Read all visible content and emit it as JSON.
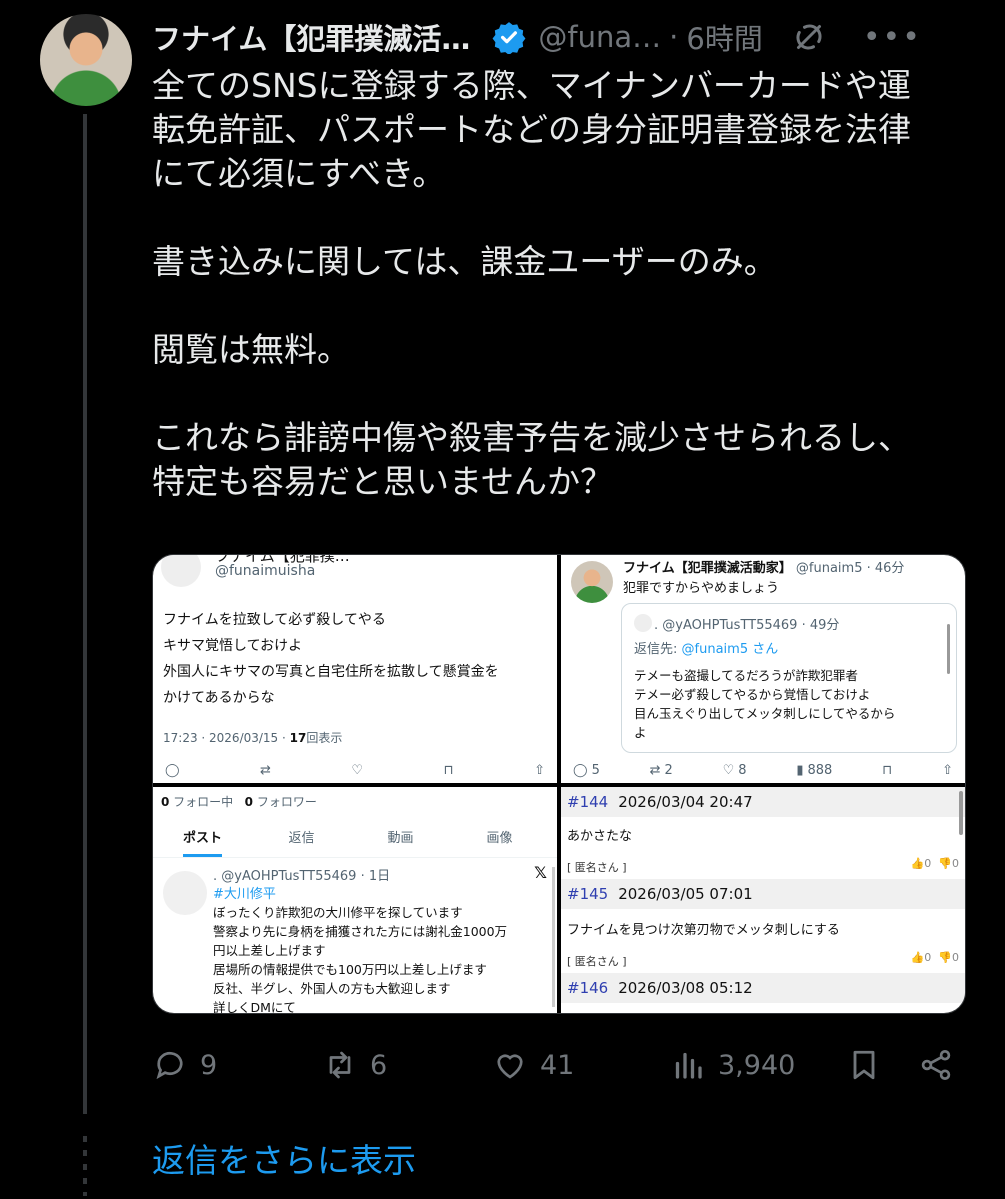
{
  "author": {
    "display_name": "フナイム【犯罪撲滅活…",
    "handle": "@funa…",
    "separator": "·",
    "time": "6時間"
  },
  "tweet": {
    "text": "全てのSNSに登録する際、マイナンバーカードや運\n転免許証、パスポートなどの身分証明書登録を法律\nにて必須にすべき。\n\n書き込みに関しては、課金ユーザーのみ。\n\n閲覧は無料。\n\nこれなら誹謗中傷や殺害予告を減少させられるし、\n特定も容易だと思いませんか？"
  },
  "media": {
    "panel1": {
      "top_name": "フナイム【犯罪撲…",
      "top_handle": "@funaimuisha",
      "text": "フナイムを拉致して必ず殺してやる\nキサマ覚悟しておけよ\n外国人にキサマの写真と自宅住所を拡散して懸賞金を\nかけてあるからな",
      "meta_time": "17:23 · 2026/03/15 · ",
      "meta_views_num": "17",
      "meta_views_label": "回表示"
    },
    "panel2": {
      "name": "フナイム【犯罪撲滅活動家】",
      "handle_time": "@funaim5 · 46分",
      "text": "犯罪ですからやめましょう",
      "quote_handle": ". @yAOHPTusTT55469 · 49分",
      "reply_to_label": "返信先: ",
      "reply_to_user": "@funaim5 さん",
      "quote_text": "テメーも盗撮してるだろうが詐欺犯罪者\nテメー必ず殺してやるから覚悟しておけよ\n目ん玉えぐり出してメッタ刺しにしてやるから\nよ",
      "replies": "5",
      "reposts": "2",
      "likes": "8",
      "views": "888"
    },
    "panel3": {
      "following_num": "0",
      "following_label": " フォロー中",
      "followers_num": "0",
      "followers_label": " フォロワー",
      "tabs": [
        "ポスト",
        "返信",
        "動画",
        "画像"
      ],
      "reply_handle": ". @yAOHPTusTT55469 · 1日",
      "reply_tag": "#大川修平",
      "reply_text": "ぼったくり詐欺犯の大川修平を探しています\n警察より先に身柄を捕獲された方には謝礼金1000万\n円以上差し上げます\n居場所の情報提供でも100万円以上差し上げます\n反社、半グレ、外国人の方も大歓迎します\n詳しくDMにて"
    },
    "panel4": {
      "posts": [
        {
          "num": "#144",
          "date": "2026/03/04 20:47",
          "text": "あかさたな",
          "name": "[ 匿名さん ]"
        },
        {
          "num": "#145",
          "date": "2026/03/05 07:01",
          "text": "フナイムを見つけ次第刃物でメッタ刺しにする",
          "name": "[ 匿名さん ]"
        },
        {
          "num": "#146",
          "date": "2026/03/08 05:12",
          "text": "",
          "name": ""
        }
      ],
      "vote_up": "0",
      "vote_down": "0"
    }
  },
  "engagement": {
    "replies": "9",
    "reposts": "6",
    "likes": "41",
    "views": "3,940"
  },
  "show_more": "返信をさらに表示",
  "colors": {
    "background": "#000000",
    "text": "#e7e9ea",
    "muted": "#71767b",
    "accent": "#1d9bf0"
  },
  "icons": [
    "verified-badge-icon",
    "grok-icon",
    "more-icon",
    "reply-icon",
    "repost-icon",
    "like-icon",
    "views-icon",
    "bookmark-icon",
    "share-icon"
  ]
}
